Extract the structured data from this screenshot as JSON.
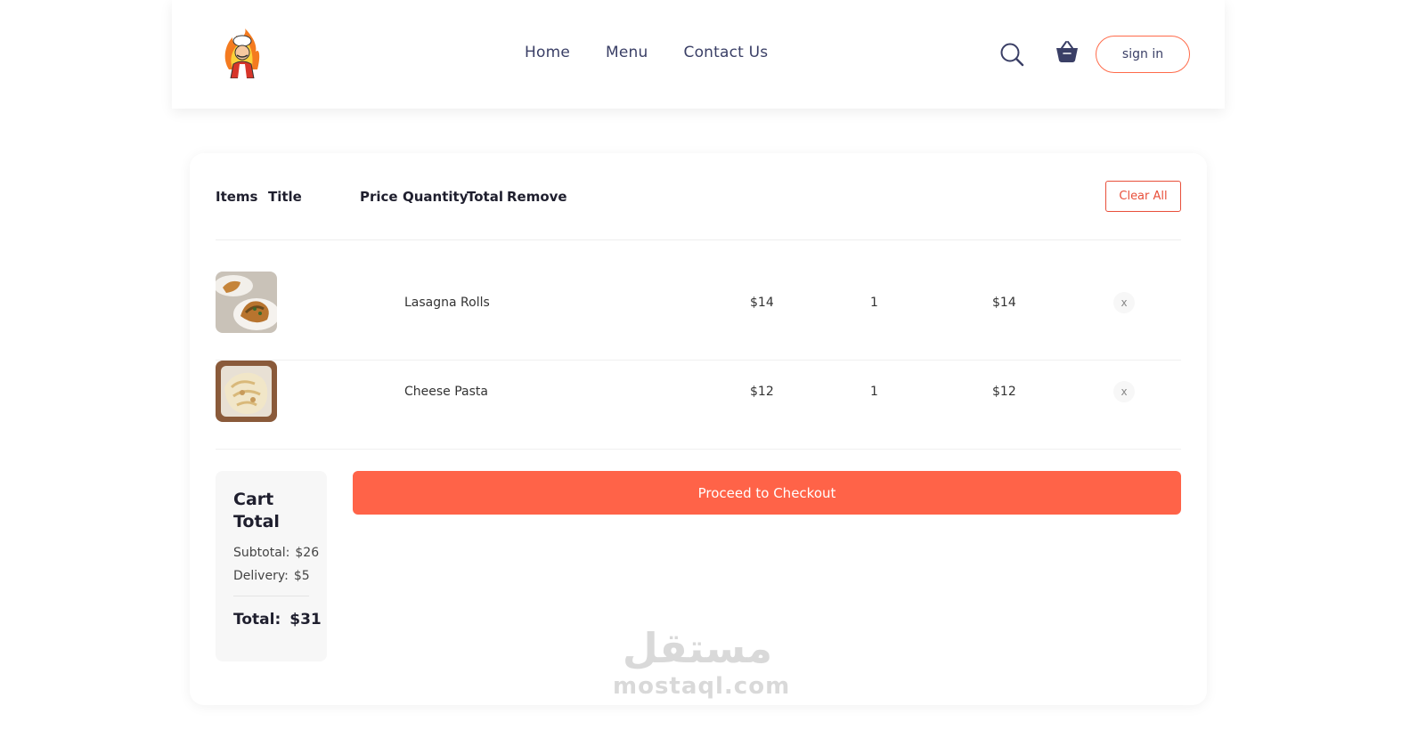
{
  "header": {
    "nav": [
      "Home",
      "Menu",
      "Contact Us"
    ],
    "icons": {
      "logo": "chef-logo",
      "search": "search-icon",
      "cart": "basket-icon"
    },
    "signin_label": "sign in"
  },
  "cart": {
    "columns": [
      "Items",
      "Title",
      "Price",
      "Quantity",
      "Total",
      "Remove"
    ],
    "clear_label": "Clear All",
    "rows": [
      {
        "title": "Lasagna Rolls",
        "price": "$14",
        "quantity": "1",
        "total": "$14",
        "remove": "x"
      },
      {
        "title": "Cheese Pasta",
        "price": "$12",
        "quantity": "1",
        "total": "$12",
        "remove": "x"
      }
    ]
  },
  "totals": {
    "heading": "Cart Total",
    "subtotal_label": "Subtotal:",
    "subtotal_value": "$26",
    "delivery_label": "Delivery:",
    "delivery_value": "$5",
    "total_label": "Total:",
    "total_value": "$31"
  },
  "checkout_label": "Proceed to Checkout",
  "watermark": {
    "arabic": "مستقل",
    "latin": "mostaql.com"
  },
  "colors": {
    "accent": "#ff6348",
    "nav": "#3a3f66",
    "clear": "#e84f3a"
  }
}
